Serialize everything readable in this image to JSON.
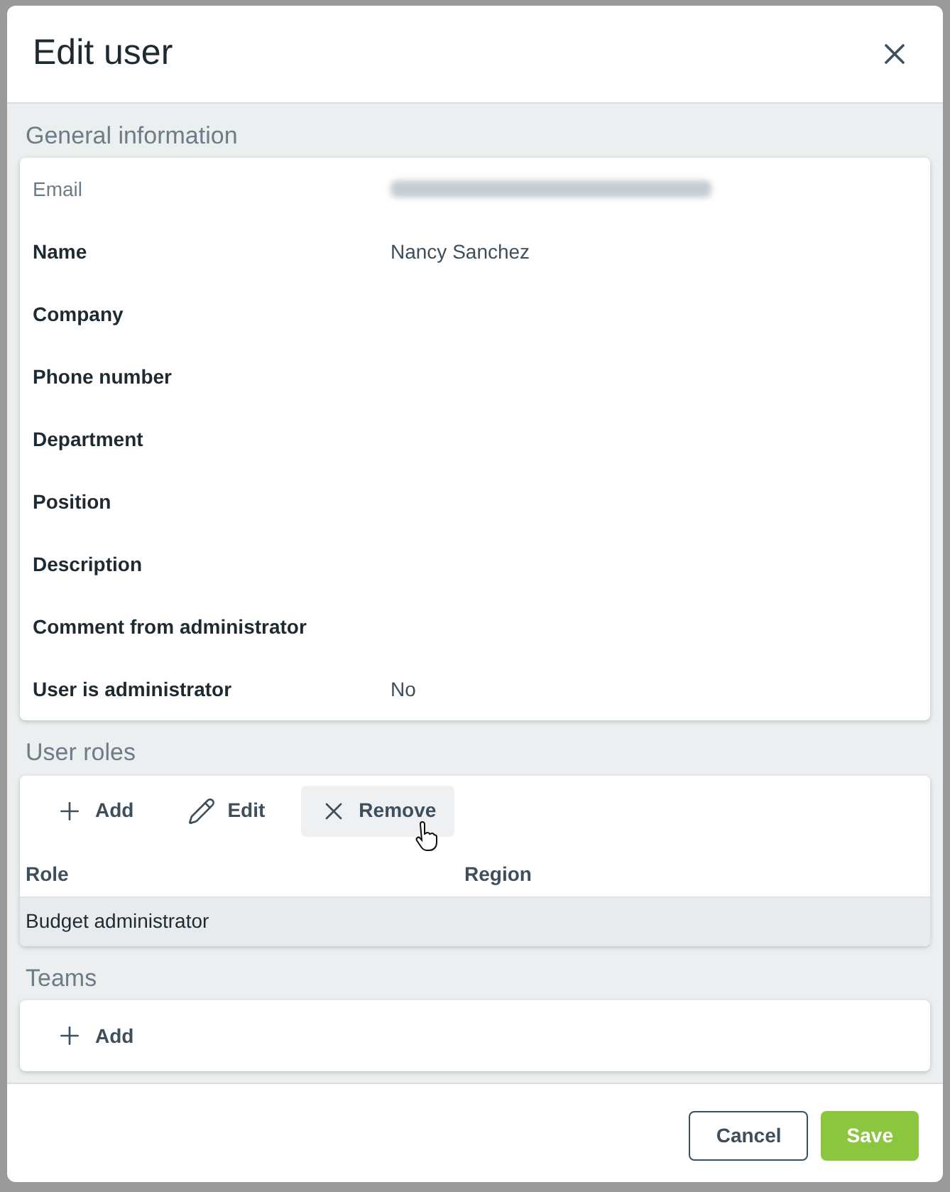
{
  "dialog": {
    "title": "Edit user"
  },
  "general_information": {
    "title": "General information",
    "fields": [
      {
        "label": "Email",
        "disabled": true,
        "redacted": true
      },
      {
        "label": "Name",
        "disabled": false,
        "value": "Nancy Sanchez"
      },
      {
        "label": "Company",
        "disabled": false
      },
      {
        "label": "Phone number",
        "disabled": false
      },
      {
        "label": "Department",
        "disabled": false
      },
      {
        "label": "Position",
        "disabled": false
      },
      {
        "label": "Description",
        "disabled": false
      },
      {
        "label": "Comment from administrator",
        "disabled": false
      },
      {
        "label": "User is administrator",
        "disabled": false,
        "value": "No"
      }
    ]
  },
  "user_roles": {
    "title": "User roles",
    "toolbar": [
      {
        "kind": "add",
        "label": "Add",
        "hovered": false
      },
      {
        "kind": "edit",
        "label": "Edit",
        "hovered": false
      },
      {
        "kind": "remove",
        "label": "Remove",
        "hovered": true
      }
    ],
    "columns": [
      "Role",
      "Region"
    ],
    "rows": [
      {
        "cells": [
          "Budget administrator"
        ],
        "selected": true
      }
    ]
  },
  "teams": {
    "title": "Teams",
    "toolbar": [
      {
        "kind": "add",
        "label": "Add",
        "hovered": false
      }
    ]
  },
  "buttons": [
    {
      "kind": "secondary",
      "label": "Cancel"
    },
    {
      "kind": "primary",
      "label": "Save"
    }
  ]
}
